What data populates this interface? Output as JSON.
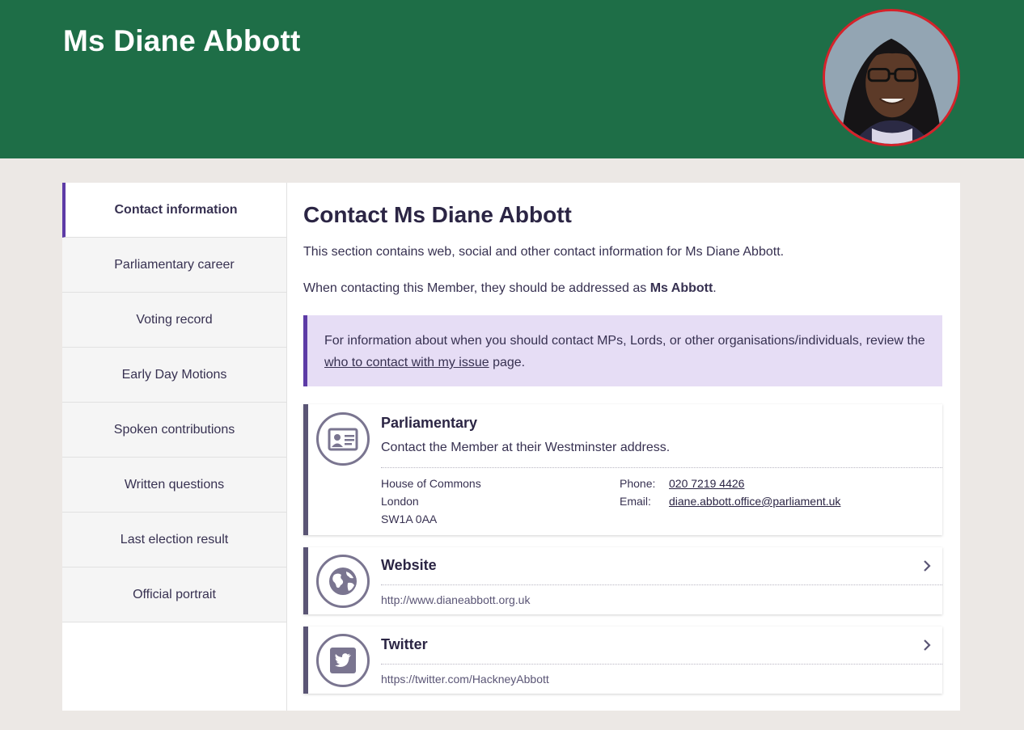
{
  "header": {
    "title": "Ms Diane Abbott",
    "accent": "#1e6e47"
  },
  "sidebar": {
    "items": [
      {
        "label": "Contact information",
        "active": true
      },
      {
        "label": "Parliamentary career"
      },
      {
        "label": "Voting record"
      },
      {
        "label": "Early Day Motions"
      },
      {
        "label": "Spoken contributions"
      },
      {
        "label": "Written questions"
      },
      {
        "label": "Last election result"
      },
      {
        "label": "Official portrait"
      }
    ]
  },
  "main": {
    "title": "Contact Ms Diane Abbott",
    "intro": "This section contains web, social and other contact information for Ms Diane Abbott.",
    "addressed_prefix": "When contacting this Member, they should be addressed as ",
    "addressed_name": "Ms Abbott",
    "addressed_suffix": ".",
    "notice": {
      "prefix": "For information about when you should contact MPs, Lords, or other organisations/individuals, review the ",
      "link": "who to contact with my issue",
      "suffix": " page."
    },
    "parliamentary": {
      "title": "Parliamentary",
      "description": "Contact the Member at their Westminster address.",
      "address": [
        "House of Commons",
        "London",
        "SW1A 0AA"
      ],
      "phone_label": "Phone:",
      "phone": "020 7219 4426",
      "email_label": "Email:",
      "email": "diane.abbott.office@parliament.uk",
      "icon": "id-card-icon"
    },
    "website": {
      "title": "Website",
      "url": "http://www.dianeabbott.org.uk",
      "icon": "globe-icon"
    },
    "twitter": {
      "title": "Twitter",
      "url": "https://twitter.com/HackneyAbbott",
      "icon": "twitter-icon"
    }
  }
}
